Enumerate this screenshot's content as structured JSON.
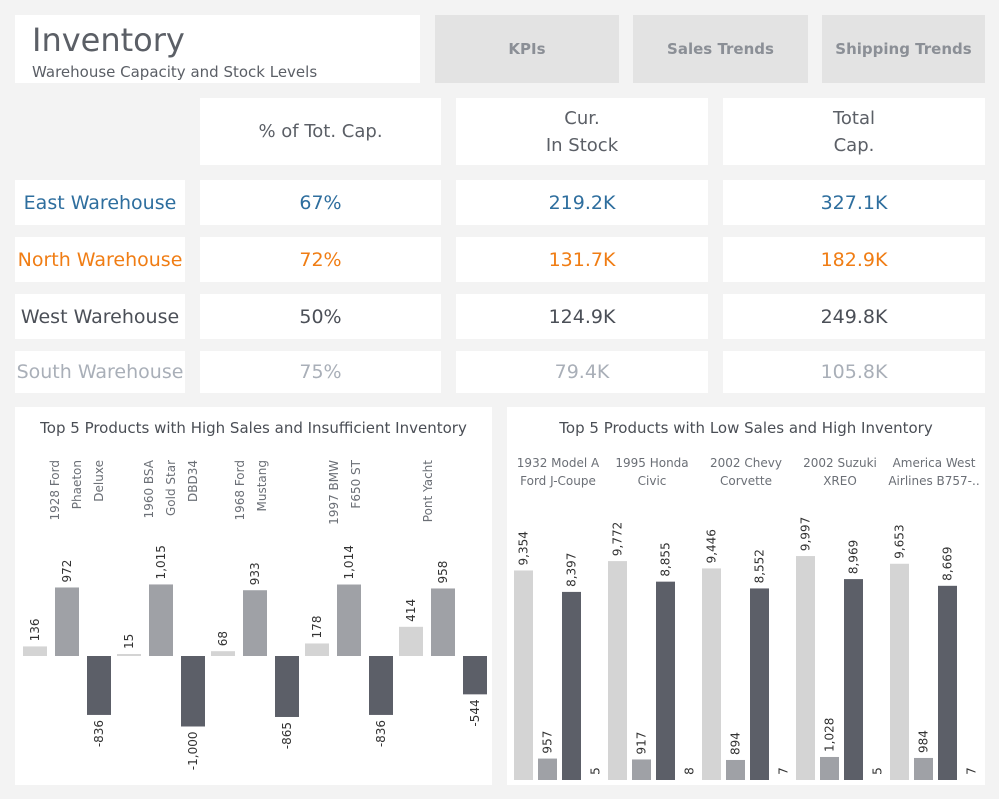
{
  "header": {
    "title": "Inventory",
    "subtitle": "Warehouse Capacity and Stock Levels"
  },
  "nav": {
    "kpis": "KPIs",
    "sales_trends": "Sales Trends",
    "shipping_trends": "Shipping Trends"
  },
  "table": {
    "columns": {
      "pct": "% of Tot. Cap.",
      "stock": "Cur.\nIn Stock",
      "cap": "Total\nCap."
    },
    "rows": [
      {
        "name": "East Warehouse",
        "pct": "67%",
        "stock": "219.2K",
        "cap": "327.1K",
        "color": "#2e6e9e"
      },
      {
        "name": "North Warehouse",
        "pct": "72%",
        "stock": "131.7K",
        "cap": "182.9K",
        "color": "#f07d14"
      },
      {
        "name": "West Warehouse",
        "pct": "50%",
        "stock": "124.9K",
        "cap": "249.8K",
        "color": "#4b4f57"
      },
      {
        "name": "South Warehouse",
        "pct": "75%",
        "stock": "79.4K",
        "cap": "105.8K",
        "color": "#a9afb8"
      }
    ]
  },
  "chart_data": [
    {
      "type": "bar",
      "title": "Top 5 Products with High Sales and Insufficient Inventory",
      "categories": [
        "1928 Ford\nPhaeton\nDeluxe",
        "1960 BSA\nGold Star\nDBD34",
        "1968 Ford\nMustang",
        "1997 BMW\nF650 ST",
        "Pont Yacht"
      ],
      "series": [
        {
          "values": [
            136,
            15,
            68,
            178,
            414
          ],
          "color": "#d4d4d4"
        },
        {
          "values": [
            972,
            1015,
            933,
            1014,
            958
          ],
          "color": "#9fa1a6"
        },
        {
          "values": [
            -836,
            -1000,
            -865,
            -836,
            -544
          ],
          "color": "#5c5f68"
        }
      ],
      "value_labels": [
        [
          "136",
          "15",
          "68",
          "178",
          "414"
        ],
        [
          "972",
          "1,015",
          "933",
          "1,014",
          "958"
        ],
        [
          "-836",
          "-1,000",
          "-865",
          "-836",
          "-544"
        ]
      ]
    },
    {
      "type": "bar",
      "title": "Top 5 Products with Low Sales and High Inventory",
      "categories": [
        "1932 Model A\nFord J-Coupe",
        "1995 Honda\nCivic",
        "2002 Chevy\nCorvette",
        "2002 Suzuki\nXREO",
        "America West\nAirlines B757-.."
      ],
      "series": [
        {
          "values": [
            9354,
            9772,
            9446,
            9997,
            9653
          ],
          "color": "#d4d4d4"
        },
        {
          "values": [
            957,
            917,
            894,
            1028,
            984
          ],
          "color": "#9fa1a6"
        },
        {
          "values": [
            8397,
            8855,
            8552,
            8969,
            8669
          ],
          "color": "#5c5f68"
        },
        {
          "values": [
            5,
            8,
            7,
            5,
            7
          ],
          "color": "#5c5f68"
        }
      ],
      "value_labels": [
        [
          "9,354",
          "9,772",
          "9,446",
          "9,997",
          "9,653"
        ],
        [
          "957",
          "917",
          "894",
          "1,028",
          "984"
        ],
        [
          "8,397",
          "8,855",
          "8,552",
          "8,969",
          "8,669"
        ],
        [
          "5",
          "8",
          "7",
          "5",
          "7"
        ]
      ]
    }
  ]
}
